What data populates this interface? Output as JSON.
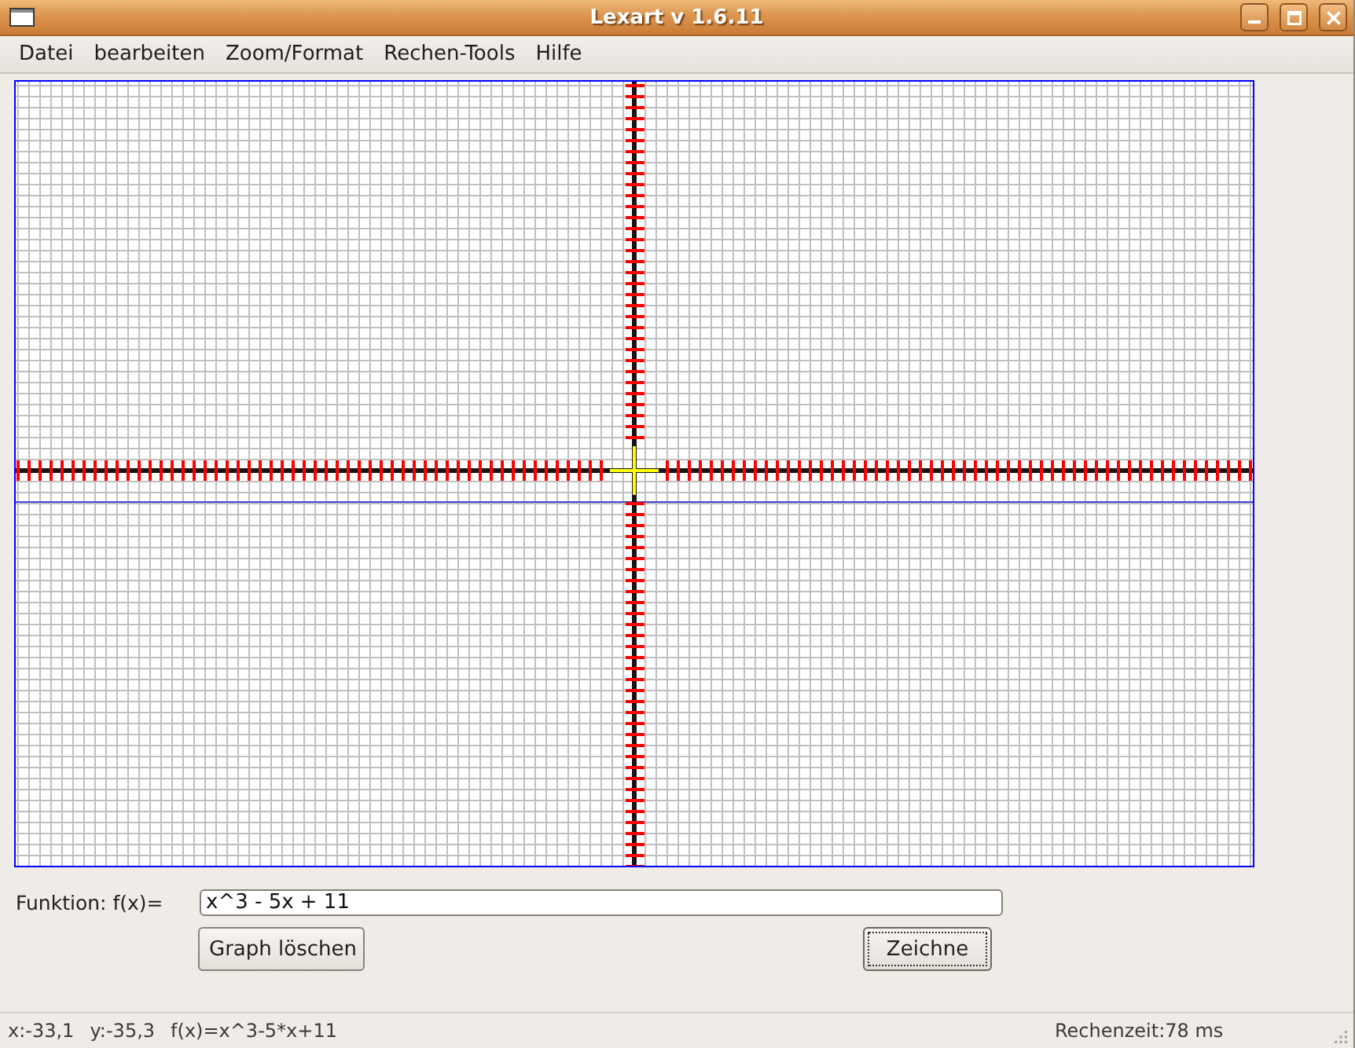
{
  "window": {
    "title": "Lexart v 1.6.11"
  },
  "menu": [
    "Datei",
    "bearbeiten",
    "Zoom/Format",
    "Rechen-Tools",
    "Hilfe"
  ],
  "function_input": {
    "label": "Funktion: f(x)=",
    "value": "x^3 - 5x + 11"
  },
  "buttons": [
    {
      "label": "Graph löschen",
      "focused": false
    },
    {
      "label": "Zeichne",
      "focused": true
    }
  ],
  "status_bar": {
    "left": [
      "x:-33,1",
      "y:-35,3",
      "f(x)=x^3-5*x+11"
    ],
    "right": "Rechenzeit:78 ms"
  }
}
